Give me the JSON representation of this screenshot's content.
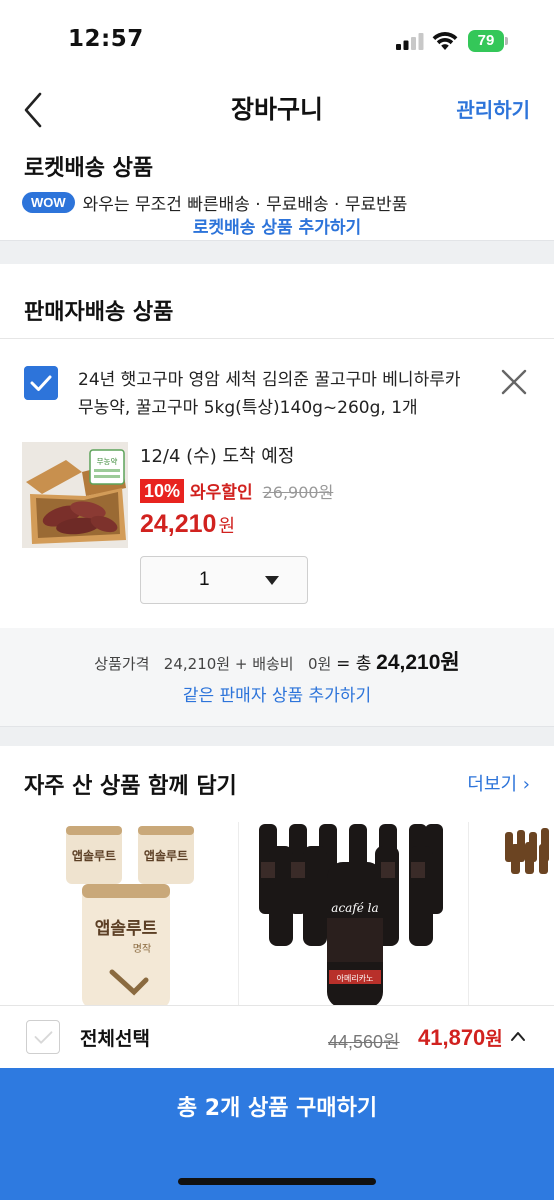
{
  "status_bar": {
    "time": "12:57",
    "battery": "79"
  },
  "header": {
    "title": "장바구니",
    "manage": "관리하기"
  },
  "rocket": {
    "title": "로켓배송 상품",
    "wow_badge": "WOW",
    "wow_text": "와우는 무조건 빠른배송 · 무료배송 · 무료반품",
    "peek_link": "로켓배송 상품 추가하기"
  },
  "seller": {
    "title": "판매자배송 상품",
    "item": {
      "name": "24년 햇고구마 영암 세척 김의준 꿀고구마 베니하루카 무농약, 꿀고구마 5kg(특상)140g~260g, 1개",
      "arrival": "12/4 (수) 도착 예정",
      "discount_badge": "10%",
      "discount_label": "와우할인",
      "original_price": "26,900원",
      "price": "24,210",
      "price_unit": "원",
      "quantity": "1",
      "checked": true
    },
    "thumb_label": "무농약"
  },
  "summary": {
    "product_label": "상품가격",
    "product_price": "24,210원",
    "shipping_label": "+ 배송비",
    "shipping_price": "0원",
    "total_label": "= 총",
    "total_amount": "24,210원",
    "add_same_seller": "같은 판매자 상품 추가하기"
  },
  "frequent": {
    "title": "자주 산 상품 함께 담기",
    "more": "더보기 ›",
    "items": [
      {
        "brand_text": "앱솔루트",
        "sub_text": "명작"
      },
      {
        "brand_text": "acafé la",
        "sub_text": "아메리카노"
      }
    ]
  },
  "bottom": {
    "select_all": "전체선택",
    "original_total": "44,560원",
    "total": "41,870",
    "total_unit": "원",
    "buy_button": "총 2개 상품 구매하기"
  },
  "colors": {
    "accent": "#2d74da",
    "sale_red": "#d1221f",
    "buy_button": "#2e7ae0",
    "battery_green": "#34c759"
  }
}
